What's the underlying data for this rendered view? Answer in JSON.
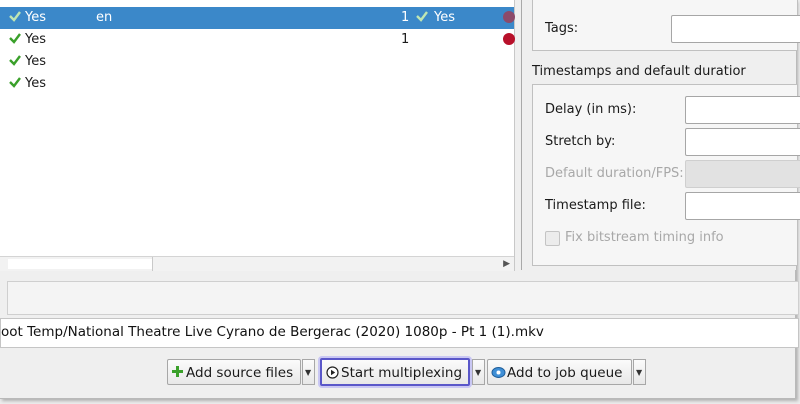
{
  "tracks": [
    {
      "enabled": "Yes",
      "language": "en",
      "number": "1",
      "default": "Yes",
      "selected": true,
      "stop": true
    },
    {
      "enabled": "Yes",
      "language": "",
      "number": "1",
      "default": "",
      "selected": false,
      "stop": true
    },
    {
      "enabled": "Yes",
      "language": "",
      "number": "",
      "default": "",
      "selected": false,
      "stop": false
    },
    {
      "enabled": "Yes",
      "language": "",
      "number": "",
      "default": "",
      "selected": false,
      "stop": false
    }
  ],
  "props": {
    "tags_label": "Tags:",
    "timestamps_group_title": "Timestamps and default duratior",
    "delay_label": "Delay (in ms):",
    "stretch_label": "Stretch by:",
    "default_duration_label": "Default duration/FPS:",
    "timestamp_file_label": "Timestamp file:",
    "fix_bitstream_label": "Fix bitstream timing info",
    "tags_value": "",
    "delay_value": "",
    "stretch_value": "",
    "default_duration_value": "",
    "timestamp_file_value": ""
  },
  "output": {
    "path": "oot Temp/National Theatre Live Cyrano de Bergerac (2020) 1080p - Pt 1 (1).mkv"
  },
  "buttons": {
    "add_source": "Add source files",
    "start_mux": "Start multiplexing",
    "add_queue": "Add to job queue"
  },
  "icons": {
    "check": "check-icon",
    "stop": "stop-icon",
    "add": "plus-icon",
    "start": "play-icon",
    "queue": "queue-icon"
  },
  "colors": {
    "selection": "#3b88c9",
    "check_green": "#3aa02a",
    "stop_red": "#b8102a",
    "focus_ring": "#5a57c9"
  }
}
